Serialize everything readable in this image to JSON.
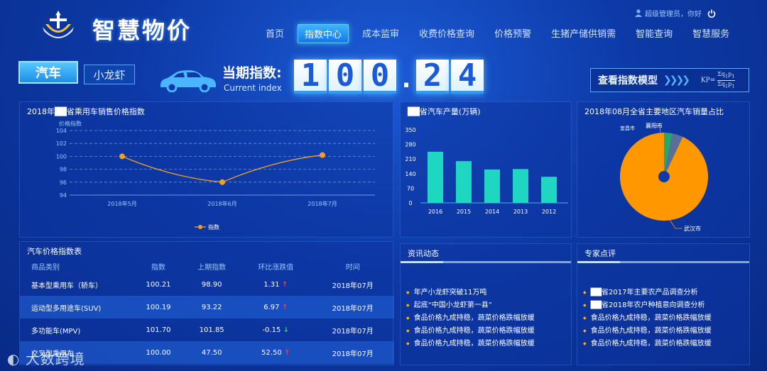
{
  "header": {
    "title": "智慧物价",
    "user_text": "超级管理员，你好",
    "nav": [
      "首页",
      "指数中心",
      "成本监审",
      "收费价格查询",
      "价格预警",
      "生猪产储供销需",
      "智能查询",
      "智慧服务"
    ],
    "active_nav": 1
  },
  "categories": {
    "primary": "汽车",
    "secondary": "小龙虾"
  },
  "index": {
    "label": "当期指数:",
    "sub_label": "Current index",
    "digits": [
      "1",
      "0",
      "0",
      ".",
      "2",
      "4"
    ]
  },
  "model_button": {
    "label": "查看指数模型",
    "formula": "KP="
  },
  "line_panel": {
    "title": "2018年██省乘用车销售价格指数",
    "chart_data": {
      "type": "line",
      "x": [
        "2018年5月",
        "2018年6月",
        "2018年7月"
      ],
      "series": [
        {
          "name": "指数",
          "values": [
            100.0,
            96.0,
            100.2
          ]
        }
      ],
      "ylabel": "价格指数",
      "ylim": [
        94,
        104
      ],
      "yticks": [
        94,
        96,
        98,
        100,
        102,
        104
      ],
      "grid": true,
      "legend": "bottom",
      "color": "#f0a020"
    }
  },
  "bar_panel": {
    "title": "██省汽车产量(万辆)",
    "chart_data": {
      "type": "bar",
      "categories": [
        "2016",
        "2015",
        "2014",
        "2013",
        "2012"
      ],
      "values": [
        245,
        200,
        160,
        162,
        125
      ],
      "ylim": [
        0,
        350
      ],
      "yticks": [
        0,
        70,
        140,
        210,
        280,
        350
      ],
      "color": "#1fd6c2"
    }
  },
  "pie_panel": {
    "title": "2018年08月全省主要地区汽车销量占比",
    "chart_data": {
      "type": "pie",
      "labels": [
        "襄阳市",
        "宜昌市",
        "武汉市"
      ],
      "values": [
        3,
        4,
        93
      ],
      "colors": [
        "#26a86a",
        "#5a6e9a",
        "#ff9800"
      ]
    }
  },
  "table_panel": {
    "title": "汽车价格指数表",
    "columns": [
      "商品类别",
      "指数",
      "上期指数",
      "环比涨跌值",
      "时间"
    ],
    "rows": [
      {
        "name": "基本型乘用车（轿车）",
        "index": "100.21",
        "prev": "98.90",
        "change": "1.31",
        "dir": "up",
        "time": "2018年07月"
      },
      {
        "name": "运动型多用途车(SUV)",
        "index": "100.19",
        "prev": "93.22",
        "change": "6.97",
        "dir": "up",
        "time": "2018年07月"
      },
      {
        "name": "多功能车(MPV)",
        "index": "101.70",
        "prev": "101.85",
        "change": "-0.15",
        "dir": "down",
        "time": "2018年07月"
      },
      {
        "name": "交叉型乘用车",
        "index": "100.00",
        "prev": "47.50",
        "change": "52.50",
        "dir": "up",
        "time": "2018年07月"
      }
    ]
  },
  "news_panel": {
    "title": "资讯动态",
    "items": [
      "年产小龙虾突破11万吨",
      "起底“中国小龙虾第一县”",
      "食品价格九成持稳，蔬菜价格跌幅放缓",
      "食品价格九成持稳，蔬菜价格跌幅放缓",
      "食品价格九成持稳，蔬菜价格跌幅放缓"
    ]
  },
  "expert_panel": {
    "title": "专家点评",
    "items": [
      "██省2017年主要农产品调查分析",
      "██省2018年农户种植意向调查分析",
      "食品价格九成持稳，蔬菜价格跌幅放缓",
      "食品价格九成持稳，蔬菜价格跌幅放缓",
      "食品价格九成持稳，蔬菜价格跌幅放缓"
    ]
  },
  "watermark": "大数跨境",
  "icons": {
    "logo": "emblem-icon",
    "car": "car-icon",
    "user": "user-icon",
    "power": "power-icon"
  }
}
